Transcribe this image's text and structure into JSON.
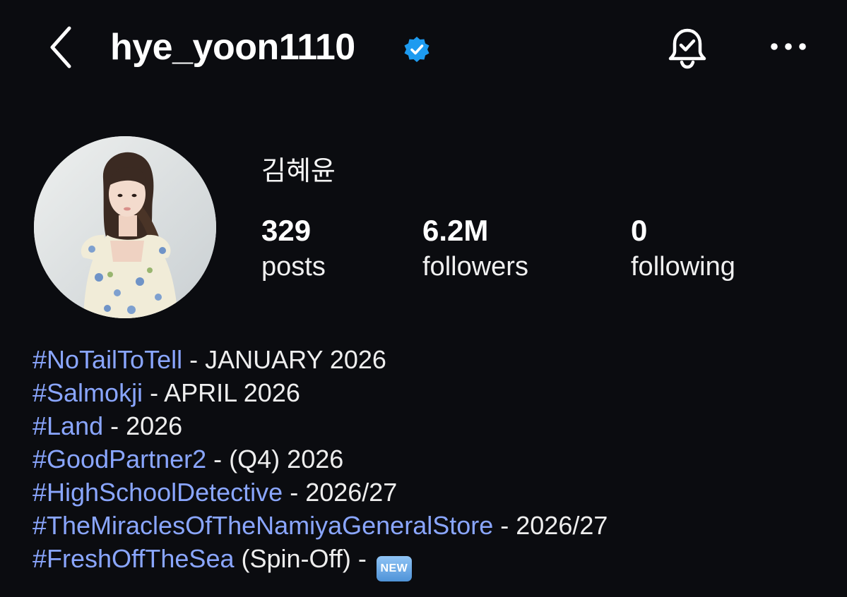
{
  "header": {
    "username": "hye_yoon1110",
    "back_icon": "chevron-left-icon",
    "verified_icon": "verified-badge-icon",
    "bell_icon": "bell-check-icon",
    "more_icon": "more-horizontal-icon"
  },
  "profile": {
    "display_name": "김혜윤",
    "stats": {
      "posts": {
        "value": "329",
        "label": "posts"
      },
      "followers": {
        "value": "6.2M",
        "label": "followers"
      },
      "following": {
        "value": "0",
        "label": "following"
      }
    }
  },
  "bio": {
    "lines": [
      {
        "tag": "#NoTailToTell",
        "rest": " - JANUARY 2026"
      },
      {
        "tag": "#Salmokji",
        "rest": " - APRIL 2026"
      },
      {
        "tag": "#Land",
        "rest": " - 2026"
      },
      {
        "tag": "#GoodPartner2",
        "rest": " - (Q4) 2026"
      },
      {
        "tag": "#HighSchoolDetective",
        "rest": " - 2026/27"
      },
      {
        "tag": "#TheMiraclesOfTheNamiyaGeneralStore",
        "rest": " - 2026/27"
      },
      {
        "tag": "#FreshOffTheSea",
        "rest": " (Spin-Off) - "
      }
    ],
    "new_badge": "NEW"
  },
  "colors": {
    "background": "#0b0c10",
    "hashtag": "#8aa6ff",
    "verified": "#1d9bf0",
    "text": "#f2f2f2"
  }
}
